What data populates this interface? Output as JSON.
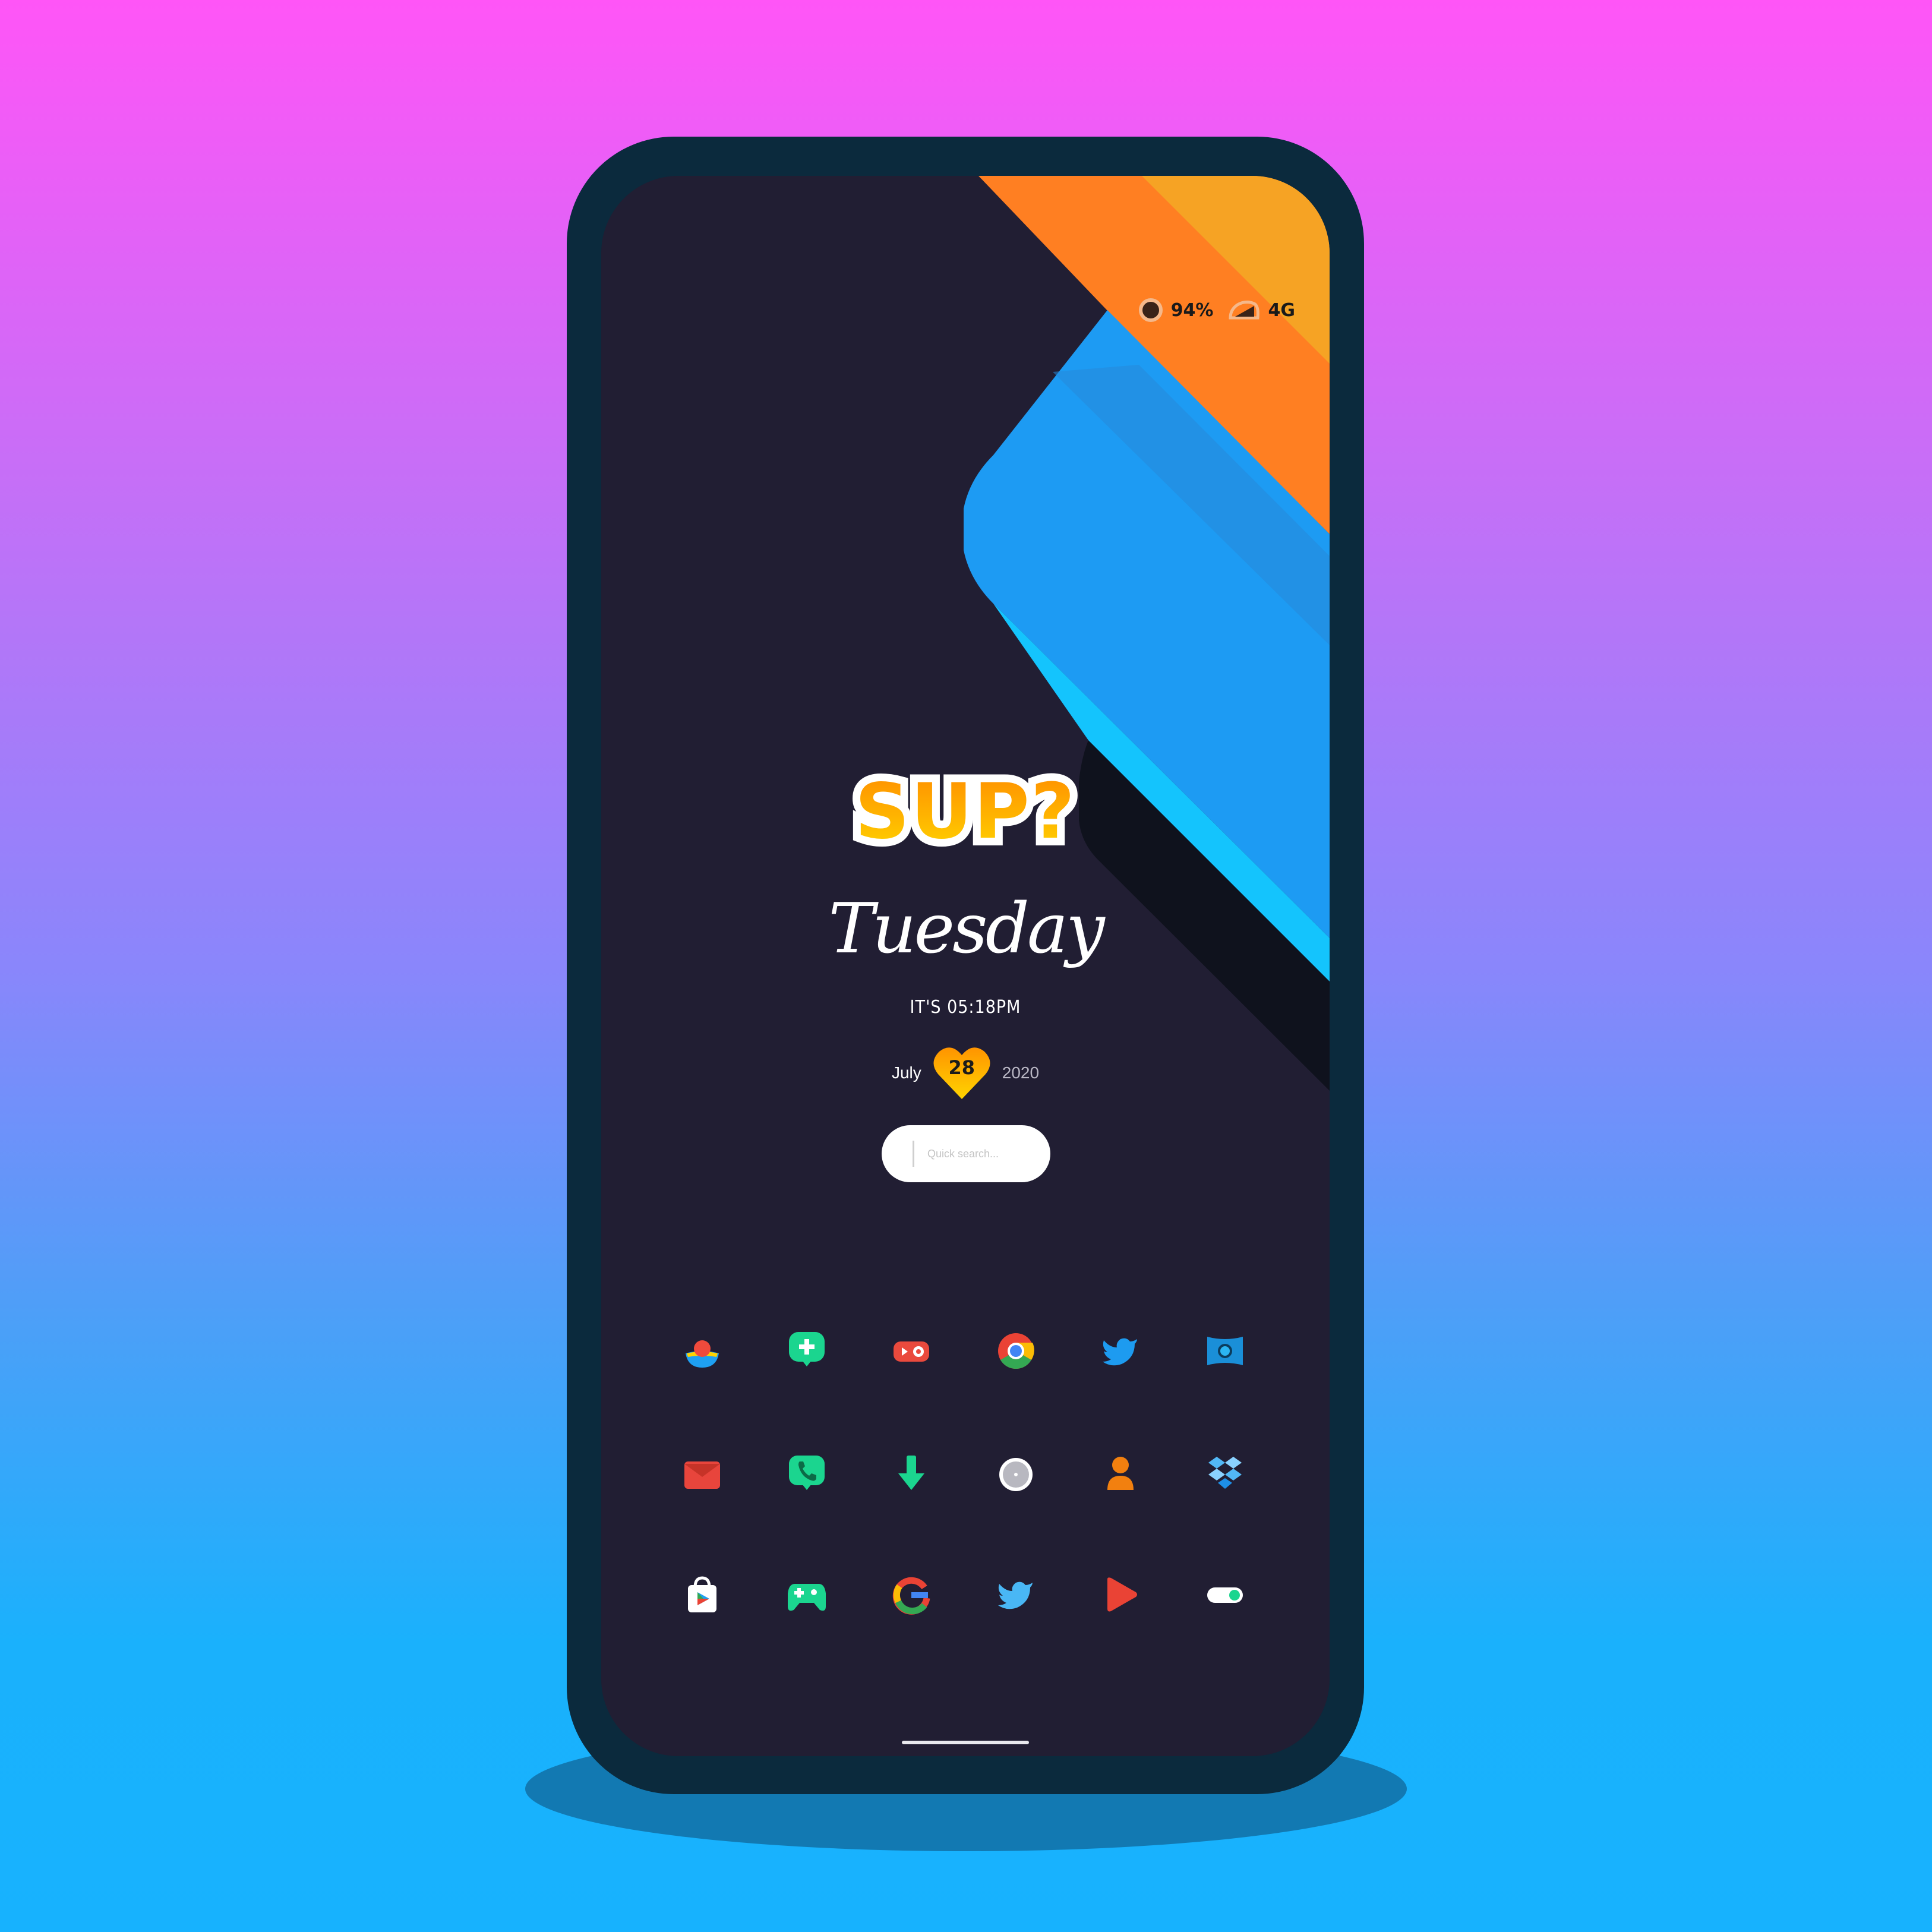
{
  "status_bar": {
    "battery": "94%",
    "network": "4G",
    "icons": [
      "battery-icon",
      "signal-icon"
    ]
  },
  "widget": {
    "greeting": "SUP?",
    "day": "Tuesday",
    "time": "IT'S 05:18PM",
    "month": "July",
    "day_number": "28",
    "year": "2020"
  },
  "search": {
    "placeholder": "Quick search..."
  },
  "apps": [
    [
      "weather-app-icon",
      "messages-app-icon",
      "video-app-icon",
      "chrome-app-icon",
      "twitter-app-icon",
      "camera-app-icon"
    ],
    [
      "mail-app-icon",
      "phone-app-icon",
      "download-app-icon",
      "clock-app-icon",
      "contacts-app-icon",
      "dropbox-app-icon"
    ],
    [
      "play-store-app-icon",
      "games-app-icon",
      "google-app-icon",
      "twitter-app-icon",
      "youtube-app-icon",
      "settings-toggle-app-icon"
    ]
  ],
  "colors": {
    "screen_bg": "#211e33",
    "accent_orange": "#ff7f22",
    "accent_blue": "#1a9cf2",
    "accent_cyan": "#14d3ff"
  }
}
